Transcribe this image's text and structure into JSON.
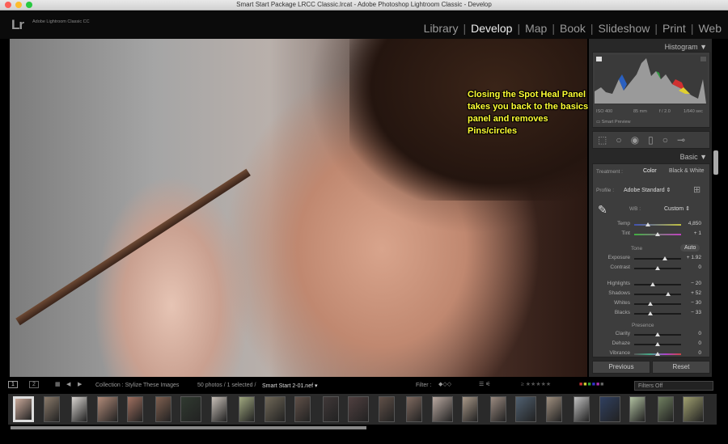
{
  "window": {
    "title": "Smart Start Package LRCC Classic.lrcat - Adobe Photoshop Lightroom Classic - Develop"
  },
  "app": {
    "logo": "Lr",
    "name": "Adobe Lightroom Classic CC"
  },
  "modules": [
    {
      "label": "Library"
    },
    {
      "label": "Develop",
      "active": true
    },
    {
      "label": "Map"
    },
    {
      "label": "Book"
    },
    {
      "label": "Slideshow"
    },
    {
      "label": "Print"
    },
    {
      "label": "Web"
    }
  ],
  "annotation": "Closing the Spot Heal Panel takes you back to the basics panel and removes Pins/circles",
  "histogram": {
    "title": "Histogram",
    "iso": "ISO 400",
    "focal": "85 mm",
    "aperture": "f / 2.0",
    "shutter": "1/640 sec",
    "smart_preview": "Smart Preview"
  },
  "basic": {
    "title": "Basic",
    "treatment_label": "Treatment :",
    "treatment_color": "Color",
    "treatment_bw": "Black & White",
    "profile_label": "Profile :",
    "profile_value": "Adobe Standard",
    "wb_label": "WB :",
    "wb_value": "Custom",
    "tone_label": "Tone",
    "auto_label": "Auto",
    "presence_label": "Presence",
    "sliders": [
      {
        "label": "Temp",
        "value": "4,850",
        "pos": 0.3
      },
      {
        "label": "Tint",
        "value": "+ 1",
        "pos": 0.5
      },
      {
        "label": "Exposure",
        "value": "+ 1.92",
        "pos": 0.66
      },
      {
        "label": "Contrast",
        "value": "0",
        "pos": 0.5
      },
      {
        "label": "Highlights",
        "value": "− 20",
        "pos": 0.4
      },
      {
        "label": "Shadows",
        "value": "+ 52",
        "pos": 0.73
      },
      {
        "label": "Whites",
        "value": "− 30",
        "pos": 0.35
      },
      {
        "label": "Blacks",
        "value": "− 33",
        "pos": 0.34
      },
      {
        "label": "Clarity",
        "value": "0",
        "pos": 0.5
      },
      {
        "label": "Dehaze",
        "value": "0",
        "pos": 0.5
      },
      {
        "label": "Vibrance",
        "value": "0",
        "pos": 0.5
      }
    ]
  },
  "buttons": {
    "previous": "Previous",
    "reset": "Reset"
  },
  "filmstrip": {
    "view1": "1",
    "view2": "2",
    "collection": "Collection : Stylize These Images",
    "count": "50 photos / 1 selected /",
    "filename": "Smart Start 2-01.nef",
    "filter_label": "Filter :",
    "filters_off": "Filters Off"
  }
}
